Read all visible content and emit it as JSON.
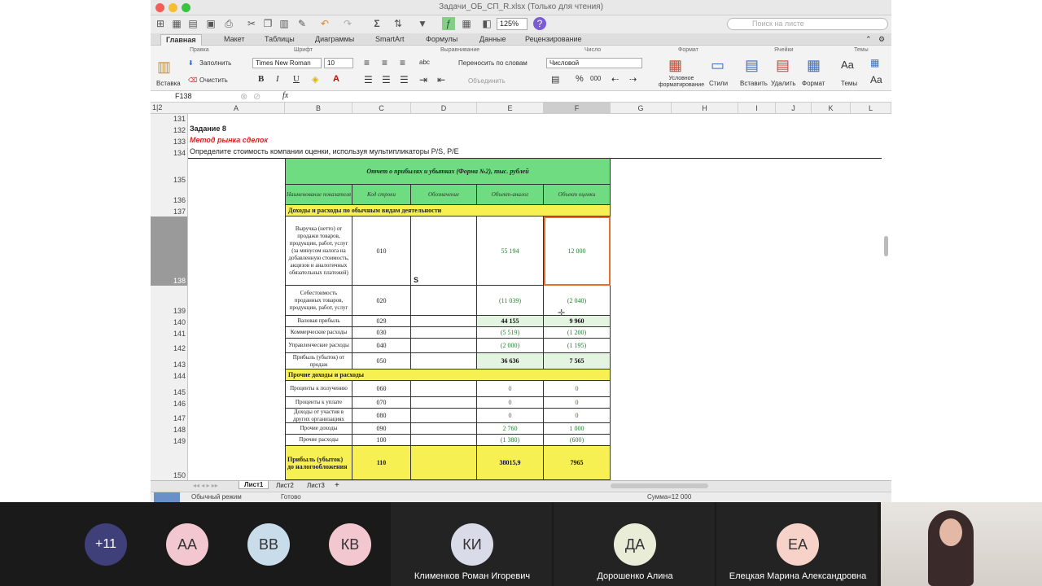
{
  "window": {
    "title": "Задачи_ОБ_СП_R.xlsx  (Только для чтения)"
  },
  "toolbar": {
    "zoom": "125%",
    "search_placeholder": "Поиск на листе"
  },
  "tabs": [
    "Главная",
    "Макет",
    "Таблицы",
    "Диаграммы",
    "SmartArt",
    "Формулы",
    "Данные",
    "Рецензирование"
  ],
  "ribbon": {
    "groups": {
      "edit": "Правка",
      "font": "Шрифт",
      "align": "Выравнивание",
      "number": "Число",
      "format": "Формат",
      "cells": "Ячейки",
      "themes": "Темы"
    },
    "paste": "Вставка",
    "fill": "Заполнить",
    "clear": "Очистить",
    "font_name": "Times New Roman",
    "font_size": "10",
    "wrap": "Переносить по словам",
    "merge": "Объединить",
    "abc": "abc",
    "number_format": "Числовой",
    "percent": "%",
    "thousands": "000",
    "cond_format": "Условное форматирование",
    "styles": "Стили",
    "insert": "Вставить",
    "delete": "Удалить",
    "format_btn": "Формат",
    "themes_btn": "Темы",
    "bold": "B",
    "italic": "I",
    "underline": "U"
  },
  "formula_bar": {
    "name_box": "F138",
    "fx": "fx",
    "content": ""
  },
  "outline": "1|2",
  "columns": [
    "A",
    "B",
    "C",
    "D",
    "E",
    "F",
    "G",
    "H",
    "I",
    "J",
    "K",
    "L"
  ],
  "rows": [
    "131",
    "132",
    "133",
    "134",
    "135",
    "136",
    "137",
    "138",
    "139",
    "140",
    "141",
    "142",
    "143",
    "144",
    "145",
    "146",
    "147",
    "148",
    "149",
    "150"
  ],
  "sheet": {
    "task_title": "Задание 8",
    "method": "Метод рынка сделок",
    "instruction": "Определите стоимость компании оценки, используя мультипликаторы P/S, P/E",
    "report_title": "Отчет о прибылях и убытках (Форма №2), тыс. рублей",
    "headers": [
      "Наименование показателя",
      "Код строки",
      "Обозначение",
      "Объект-аналог",
      "Объект оценки"
    ],
    "section1": "Доходы и расходы по обычным видам деятельности",
    "section2": "Прочие доходы и расходы",
    "cursor_char": "S",
    "items": [
      {
        "name": "Выручка (нетто) от продажи товаров, продукции, работ, услуг (за минусом налога на добавленную стоимость, акцизов и аналогичных обязательных платежей)",
        "code": "010",
        "analog": "55 194",
        "target": "12 000"
      },
      {
        "name": "Себестоимость проданных товаров, продукции, работ, услуг",
        "code": "020",
        "analog": "(11 039)",
        "target": "(2 040)"
      },
      {
        "name": "Валовая прибыль",
        "code": "029",
        "analog": "44 155",
        "target": "9 960"
      },
      {
        "name": "Коммерческие расходы",
        "code": "030",
        "analog": "(5 519)",
        "target": "(1 200)"
      },
      {
        "name": "Управленческие расходы",
        "code": "040",
        "analog": "(2 000)",
        "target": "(1 195)"
      },
      {
        "name": "Прибыль (убыток) от продаж",
        "code": "050",
        "analog": "36 636",
        "target": "7 565"
      },
      {
        "name": "Проценты к получению",
        "code": "060",
        "analog": "0",
        "target": "0"
      },
      {
        "name": "Проценты к уплате",
        "code": "070",
        "analog": "0",
        "target": "0"
      },
      {
        "name": "Доходы от участия в других организациях",
        "code": "080",
        "analog": "0",
        "target": "0"
      },
      {
        "name": "Прочие доходы",
        "code": "090",
        "analog": "2 760",
        "target": "1 000"
      },
      {
        "name": "Прочие расходы",
        "code": "100",
        "analog": "(1 380)",
        "target": "(600)"
      },
      {
        "name": "Прибыль (убыток) до налогообложения",
        "code": "110",
        "analog": "38015,9",
        "target": "7965"
      }
    ]
  },
  "sheet_tabs": [
    "Лист1",
    "Лист2",
    "Лист3",
    "+"
  ],
  "status": {
    "mode": "Обычный режим",
    "ready": "Готово",
    "sum": "Сумма=12 000"
  },
  "participants": [
    {
      "initials": "+11",
      "name": "",
      "color": "#3f3f7a"
    },
    {
      "initials": "АА",
      "name": "",
      "color": "#f3c7cf"
    },
    {
      "initials": "ВВ",
      "name": "",
      "color": "#c9dce9"
    },
    {
      "initials": "КВ",
      "name": "",
      "color": "#f3c7cf"
    },
    {
      "initials": "КИ",
      "name": "Клименков Роман Игоревич",
      "color": "#d9dbe8"
    },
    {
      "initials": "ДА",
      "name": "Дорошенко Алина",
      "color": "#e9ecd6"
    },
    {
      "initials": "ЕА",
      "name": "Елецкая Марина Александровна",
      "color": "#f6d2c9"
    }
  ],
  "colors": {
    "green": "#6fdc82",
    "yellow": "#f7f052",
    "lightgreen": "#e3f5e0",
    "green_text": "#2b7a36",
    "selection": "#e8702a"
  }
}
